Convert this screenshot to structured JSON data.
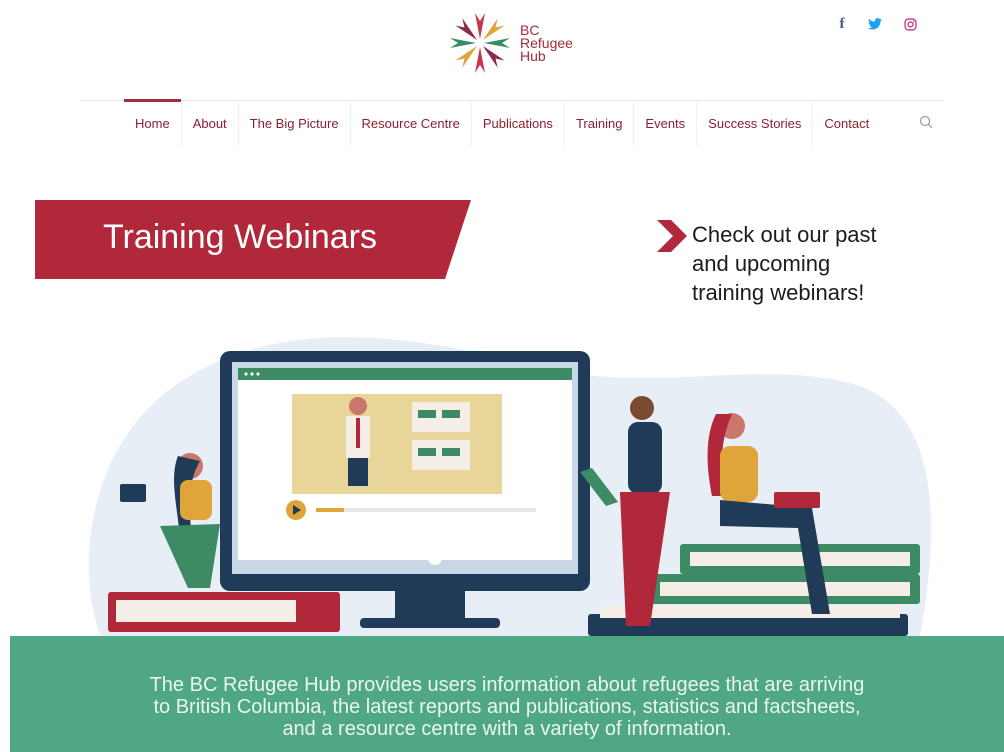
{
  "logo": {
    "line1": "BC",
    "line2": "Refugee",
    "line3": "Hub",
    "icon": "flower-star-logo-icon"
  },
  "social": {
    "facebook": {
      "glyph": "f",
      "icon": "facebook-icon"
    },
    "twitter": {
      "glyph": "🐦",
      "icon": "twitter-icon"
    },
    "instagram": {
      "icon": "instagram-icon"
    }
  },
  "nav": {
    "items": [
      {
        "label": "Home",
        "active": true
      },
      {
        "label": "About"
      },
      {
        "label": "The Big Picture"
      },
      {
        "label": "Resource Centre"
      },
      {
        "label": "Publications"
      },
      {
        "label": "Training"
      },
      {
        "label": "Events"
      },
      {
        "label": "Success Stories"
      },
      {
        "label": "Contact"
      }
    ],
    "search_icon": "search-icon"
  },
  "hero": {
    "banner_title": "Training Webinars",
    "cta_lines": [
      "Check out our past",
      "and upcoming",
      "training webinars!"
    ],
    "illustration": "people-attending-webinar-illustration"
  },
  "band": {
    "lines": [
      "The BC Refugee Hub provides users information about refugees that are arriving",
      "to British Columbia, the latest reports and publications, statistics and factsheets,",
      "and a resource centre with a variety of information."
    ]
  },
  "colors": {
    "brand_red": "#a52a3a",
    "band_green": "#4fa783",
    "monitor_navy": "#1f3b57",
    "accent_green": "#3d8a64",
    "skin_tone": "#e4c9a3"
  }
}
